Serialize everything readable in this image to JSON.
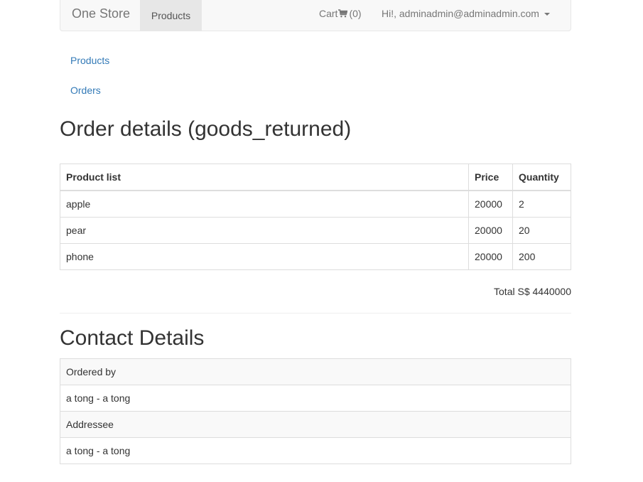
{
  "navbar": {
    "brand": "One Store",
    "active_item": "Products",
    "cart_label": "Cart",
    "cart_count": "(0)",
    "user_label": "Hi!, adminadmin@adminadmin.com",
    "icons": {
      "cart": "shopping-cart-icon",
      "user_menu": "caret-down-icon"
    }
  },
  "side_links": [
    "Products",
    "Orders"
  ],
  "order": {
    "title": "Order details (goods_returned)",
    "columns": [
      "Product list",
      "Price",
      "Quantity"
    ],
    "rows": [
      {
        "product": "apple",
        "price": "20000",
        "quantity": "2"
      },
      {
        "product": "pear",
        "price": "20000",
        "quantity": "20"
      },
      {
        "product": "phone",
        "price": "20000",
        "quantity": "200"
      }
    ],
    "total": "Total S$ 4440000"
  },
  "contact": {
    "title": "Contact Details",
    "rows": [
      "Ordered by",
      "a tong - a tong",
      "Addressee",
      "a tong - a tong"
    ]
  }
}
